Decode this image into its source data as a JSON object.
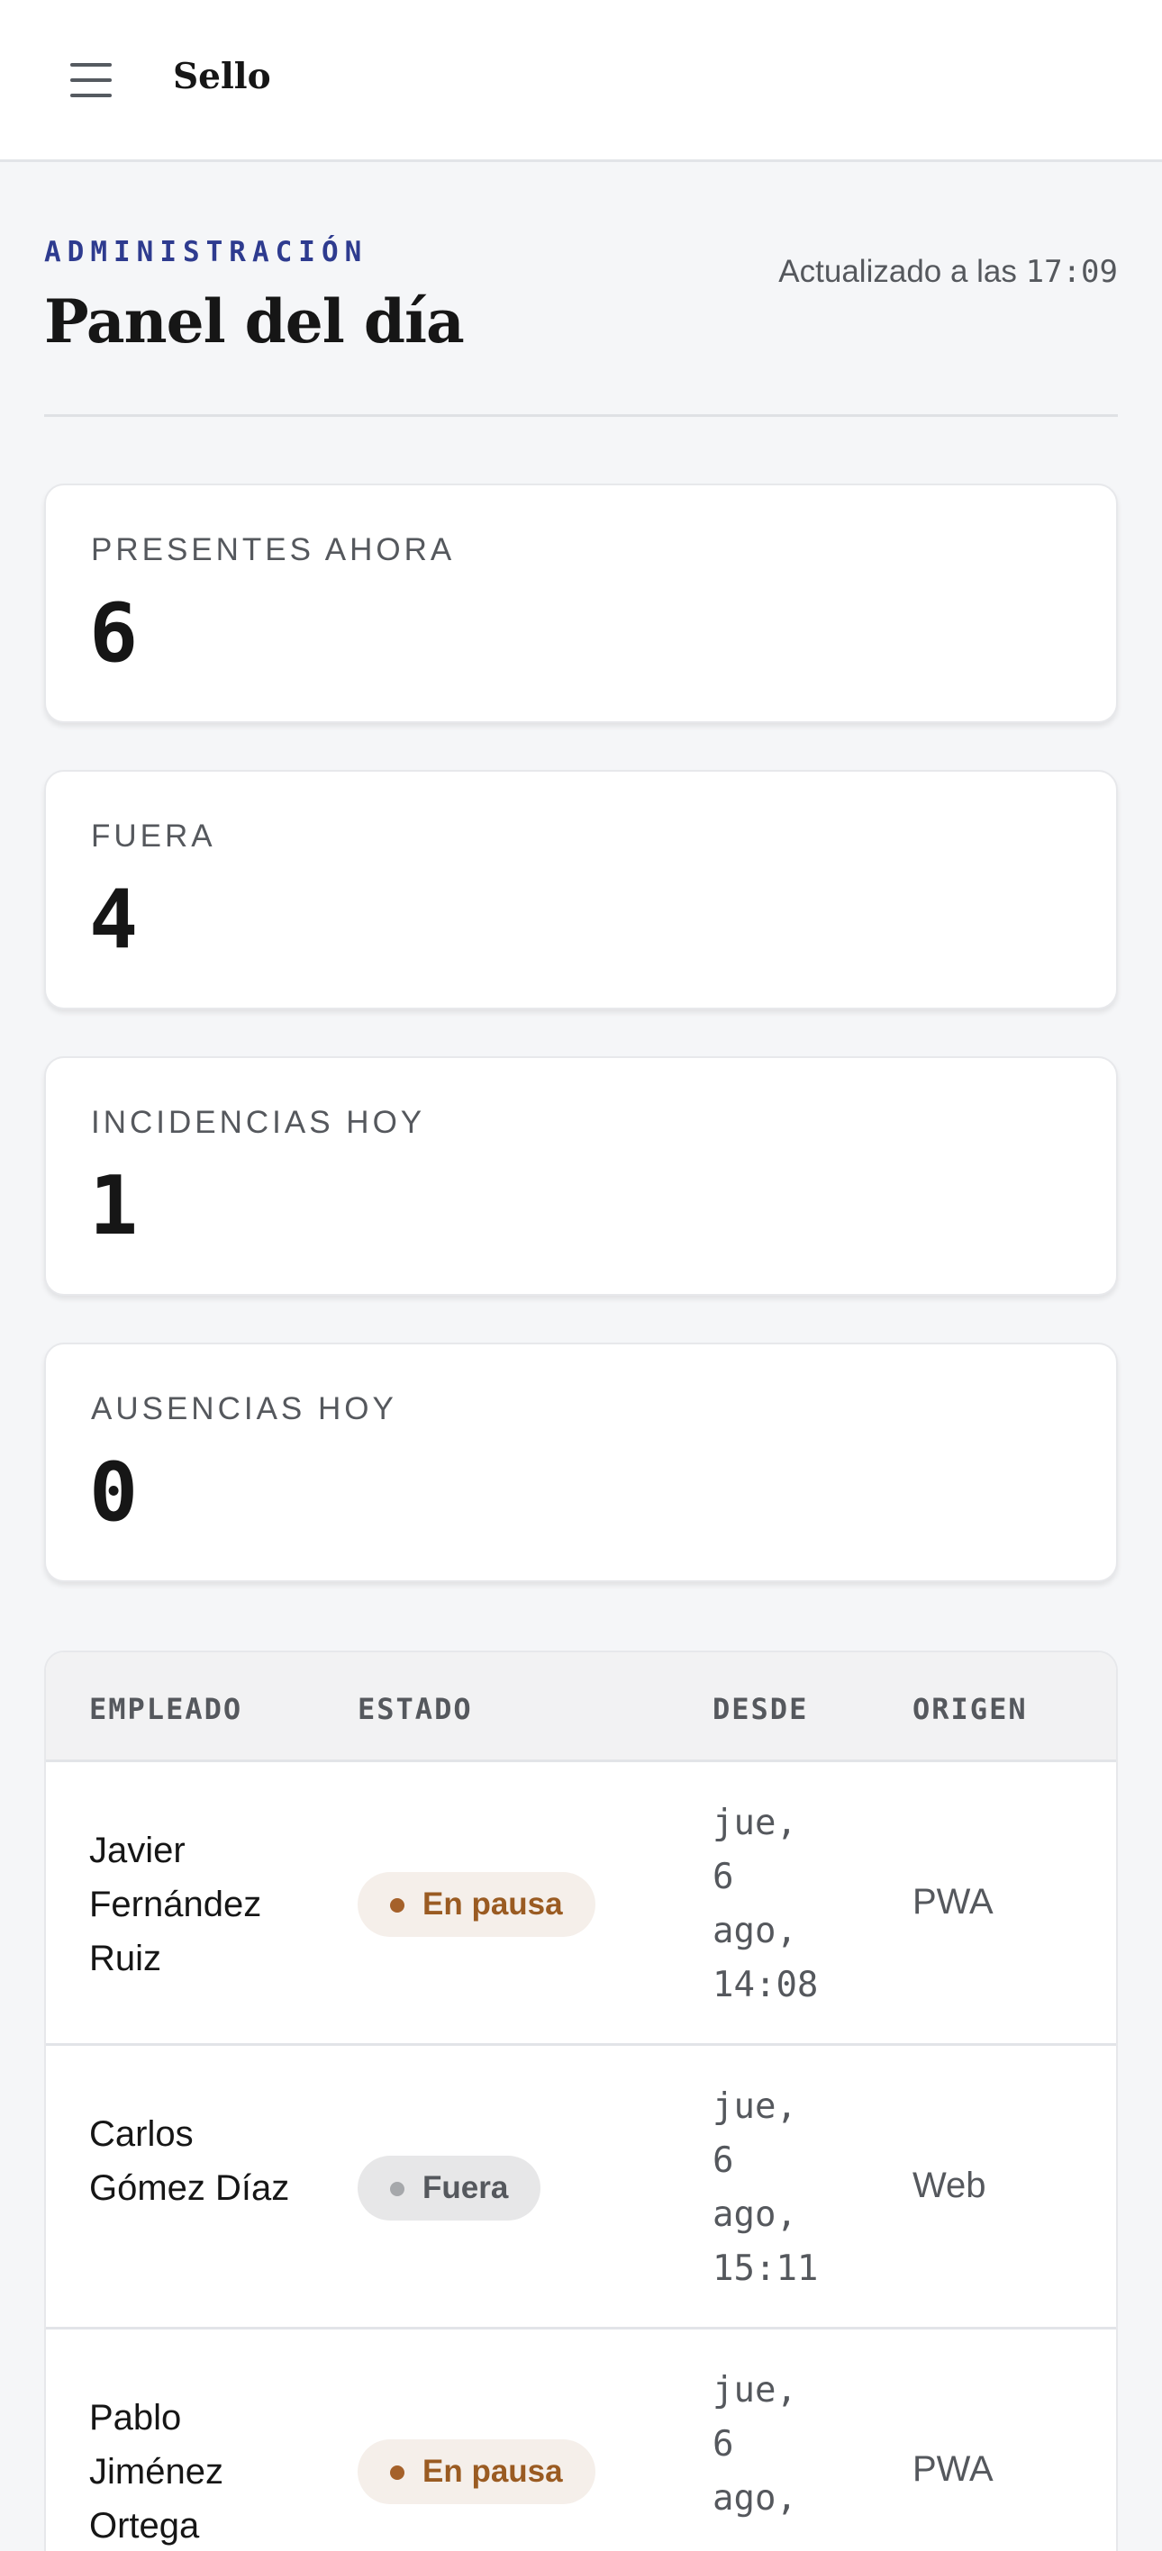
{
  "app": {
    "brand": "Sello"
  },
  "header": {
    "eyebrow": "ADMINISTRACIÓN",
    "title": "Panel del día",
    "updated_prefix": "Actualizado a las",
    "updated_time": "17:09"
  },
  "stats": [
    {
      "label": "PRESENTES AHORA",
      "value": "6"
    },
    {
      "label": "FUERA",
      "value": "4"
    },
    {
      "label": "INCIDENCIAS HOY",
      "value": "1"
    },
    {
      "label": "AUSENCIAS HOY",
      "value": "0"
    }
  ],
  "table": {
    "columns": [
      "EMPLEADO",
      "ESTADO",
      "DESDE",
      "ORIGEN"
    ],
    "rows": [
      {
        "employee": "Javier Fernández Ruiz",
        "status": "En pausa",
        "since": "jue, 6 ago, 14:08",
        "origin": "PWA"
      },
      {
        "employee": "Carlos Gómez Díaz",
        "status": "Fuera",
        "since": "jue, 6 ago, 15:11",
        "origin": "Web"
      },
      {
        "employee": "Pablo Jiménez Ortega",
        "status": "En pausa",
        "since": "jue, 6 ago,",
        "origin": "PWA"
      }
    ]
  },
  "colors": {
    "accent": "#2e3b8f",
    "pause": "#9a5b22",
    "out": "#55585d"
  },
  "icons": {
    "menu": "hamburger-menu-icon"
  }
}
